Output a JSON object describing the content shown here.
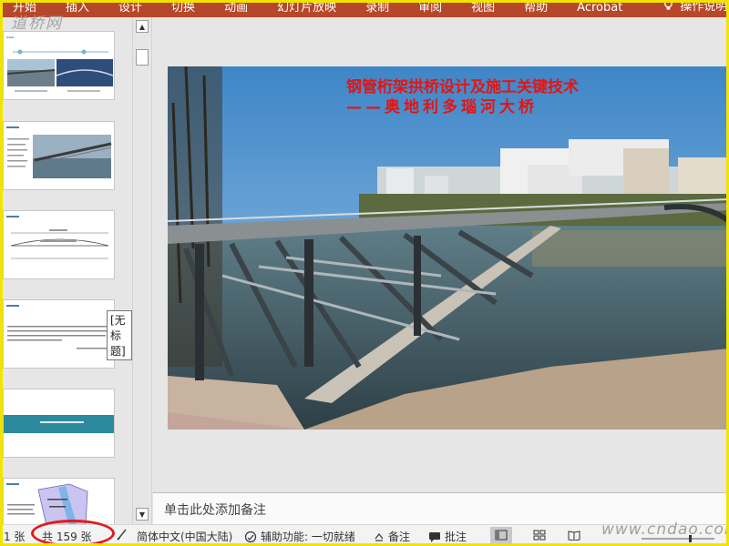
{
  "ribbon": {
    "tabs": [
      "开始",
      "插入",
      "设计",
      "切换",
      "动画",
      "幻灯片放映",
      "录制",
      "审阅",
      "视图",
      "帮助",
      "Acrobat"
    ],
    "tell_me": "操作说明搜索"
  },
  "watermark_top": "道桥网",
  "thumbnail_pane": {
    "tooltip": "[无标题]"
  },
  "slide": {
    "title_line1": "钢管桁架拱桥设计及施工关键技术",
    "title_line2": "——奥地利多瑙河大桥"
  },
  "notes": {
    "placeholder": "单击此处添加备注"
  },
  "status_bar": {
    "slide_index": "1 张",
    "slide_total": "共 159 张",
    "language": "简体中文(中国大陆)",
    "accessibility": "辅助功能: 一切就绪",
    "notes_label": "备注",
    "comments_label": "批注"
  },
  "watermark_bottom": "www.cndao.com",
  "colors": {
    "ribbon": "#b7472a",
    "title_red": "#e01616",
    "frame_yellow": "#f2e400",
    "circle_red": "#e21a1a"
  }
}
